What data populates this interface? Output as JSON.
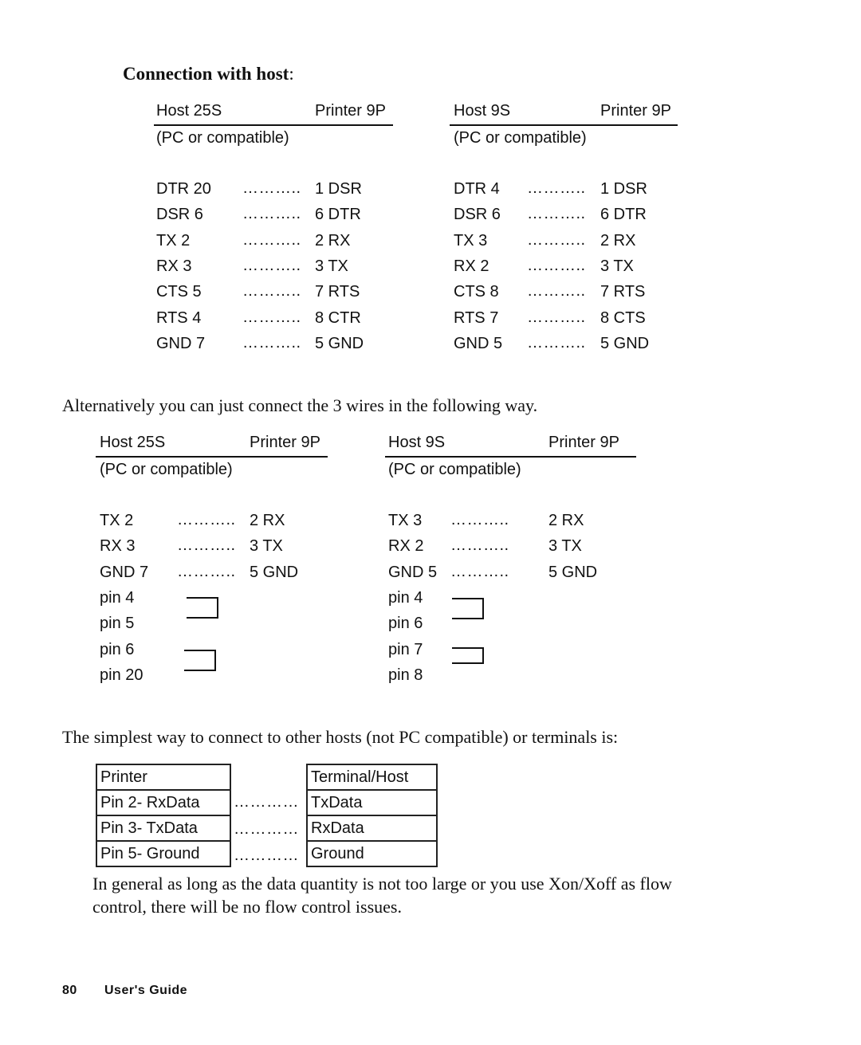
{
  "heading": {
    "title": "Connection with host",
    "colon": ":"
  },
  "section1": {
    "left": {
      "host_label": "Host 25S",
      "printer_label": "Printer 9P",
      "subtitle": "(PC or compatible)",
      "rows": [
        {
          "host": "DTR 20",
          "dots": "………..",
          "printer": "1 DSR"
        },
        {
          "host": "DSR 6",
          "dots": "………..",
          "printer": "6 DTR"
        },
        {
          "host": "TX 2",
          "dots": "………..",
          "printer": "2 RX"
        },
        {
          "host": "RX 3",
          "dots": "………..",
          "printer": "3 TX"
        },
        {
          "host": "CTS 5",
          "dots": "………..",
          "printer": "7 RTS"
        },
        {
          "host": "RTS 4",
          "dots": "………..",
          "printer": "8 CTR"
        },
        {
          "host": "GND 7",
          "dots": "………..",
          "printer": "5 GND"
        }
      ]
    },
    "right": {
      "host_label": "Host 9S",
      "printer_label": "Printer 9P",
      "subtitle": "(PC or compatible)",
      "rows": [
        {
          "host": "DTR 4",
          "dots": "………..",
          "printer": "1 DSR"
        },
        {
          "host": "DSR 6",
          "dots": "………..",
          "printer": "6 DTR"
        },
        {
          "host": "TX 3",
          "dots": "………..",
          "printer": "2 RX"
        },
        {
          "host": "RX 2",
          "dots": "………..",
          "printer": "3 TX"
        },
        {
          "host": "CTS 8",
          "dots": "………..",
          "printer": "7 RTS"
        },
        {
          "host": "RTS 7",
          "dots": "………..",
          "printer": "8 CTS"
        },
        {
          "host": "GND 5",
          "dots": "………..",
          "printer": "5 GND"
        }
      ]
    }
  },
  "paragraph1": "Alternatively you can just connect the 3 wires in the following way.",
  "section2": {
    "left": {
      "host_label": "Host 25S",
      "printer_label": "Printer 9P",
      "subtitle": "(PC or compatible)",
      "rows": [
        {
          "host": "TX 2",
          "dots": "………..",
          "printer": "2 RX"
        },
        {
          "host": "RX 3",
          "dots": "………..",
          "printer": "3 TX"
        },
        {
          "host": "GND 7",
          "dots": "………..",
          "printer": "5 GND"
        }
      ],
      "pins": [
        "pin 4",
        "pin 5",
        "pin 6",
        "pin 20"
      ]
    },
    "right": {
      "host_label": "Host 9S",
      "printer_label": "Printer 9P",
      "subtitle": "(PC or compatible)",
      "rows": [
        {
          "host": "TX 3",
          "dots": "………..",
          "printer": "2 RX"
        },
        {
          "host": "RX 2",
          "dots": "………..",
          "printer": "3 TX"
        },
        {
          "host": "GND 5",
          "dots": "………..",
          "printer": "5 GND"
        }
      ],
      "pins": [
        "pin 4",
        "pin 6",
        "pin 7",
        "pin 8"
      ]
    }
  },
  "paragraph2": "The simplest way to connect to other hosts (not PC compatible) or terminals is:",
  "section3": {
    "printer_table": [
      "Printer",
      "Pin 2- RxData",
      "Pin 3- TxData",
      "Pin 5- Ground"
    ],
    "dots": [
      "…………",
      "…………",
      "…………"
    ],
    "terminal_table": [
      "Terminal/Host",
      "TxData",
      "RxData",
      "Ground"
    ]
  },
  "paragraph3_line1": "In general as long as the data quantity is not too large or you use Xon/Xoff as flow",
  "paragraph3_line2": "control, there will be no flow control issues.",
  "footer": {
    "page_number": "80",
    "title": "User's Guide"
  }
}
